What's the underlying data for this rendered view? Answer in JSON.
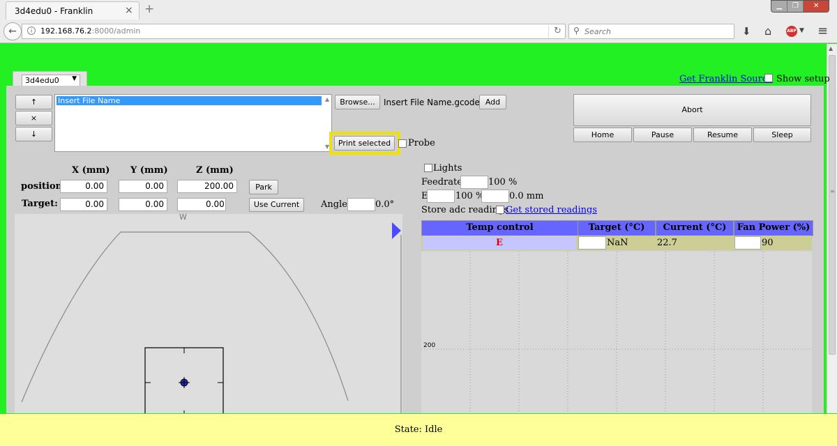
{
  "browser": {
    "tab_title": "3d4edu0 - Franklin",
    "tab_close": "×",
    "new_tab": "+",
    "url_host": "192.168.76.2",
    "url_rest": ":8000/admin",
    "search_placeholder": "Search",
    "abp_label": "ABP"
  },
  "printer": {
    "selected": "3d4edu0",
    "source_link": "Get Franklin Source",
    "show_setup_label": "Show setup",
    "show_setup_checked": false
  },
  "queue": {
    "move_up_label": "↑",
    "remove_label": "×",
    "move_down_label": "↓",
    "items": [
      "Insert File Name"
    ],
    "browse_label": "Browse...",
    "file_name": "Insert File Name.gcode",
    "add_label": "Add",
    "print_label": "Print selected",
    "probe_label": "Probe",
    "probe_checked": false
  },
  "controls": {
    "abort": "Abort",
    "home": "Home",
    "pause": "Pause",
    "resume": "Resume",
    "sleep": "Sleep"
  },
  "axes": {
    "headers": [
      "X (mm)",
      "Y (mm)",
      "Z (mm)"
    ],
    "position_label": "position",
    "target_label": "Target:",
    "position": [
      "0.00",
      "0.00",
      "200.00"
    ],
    "target": [
      "0.00",
      "0.00",
      "0.00"
    ],
    "park_label": "Park",
    "use_current_label": "Use Current",
    "angle_label": "Angle:",
    "angle_value": "0.0°",
    "map_label": "W"
  },
  "settings": {
    "lights_label": "Lights",
    "lights_checked": false,
    "feedrate_label": "Feedrate:",
    "feedrate_unit": "100 %",
    "e_label": "E",
    "e_unit": "100 %",
    "e_mm": "0.0 mm",
    "store_label": "Store adc readings",
    "store_checked": false,
    "stored_link": "Get stored readings"
  },
  "temp_table": {
    "headers": [
      "Temp control",
      "Target (°C)",
      "Current (°C)",
      "Fan Power (%)"
    ],
    "rows": [
      {
        "name": "E",
        "target": "NaN",
        "current": "22.7",
        "fan": "90"
      }
    ]
  },
  "graph": {
    "tick_200": "200"
  },
  "status": "State: Idle",
  "colors": {
    "page_bg": "#23f023",
    "table_header": "#6666ff",
    "table_row": "#cdcd96",
    "status_bg": "#ffff99",
    "highlight": "#f0e200"
  }
}
